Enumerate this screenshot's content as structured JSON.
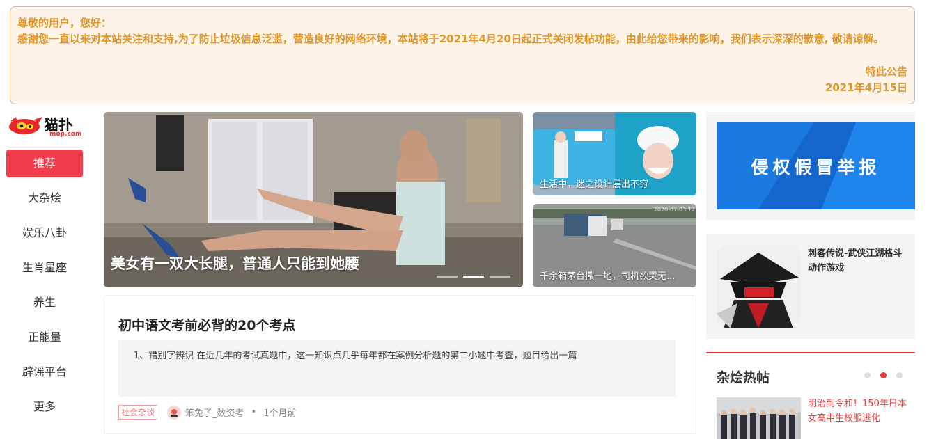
{
  "notice": {
    "greeting": "尊敬的用户，您好：",
    "body": "感谢您一直以来对本站关注和支持,为了防止垃圾信息泛滥，营造良好的网络环境，本站将于2021年4月20日起正式关闭发帖功能，由此给您带来的影响，我们表示深深的歉意, 敬请谅解。",
    "signature": "特此公告",
    "date": "2021年4月15日"
  },
  "logo": {
    "text": "猫扑",
    "domain": "mop.com"
  },
  "nav": {
    "items": [
      "推荐",
      "大杂烩",
      "娱乐八卦",
      "生肖星座",
      "养生",
      "正能量",
      "辟谣平台",
      "更多"
    ]
  },
  "hero": {
    "title": "美女有一双大长腿，普通人只能到她腰",
    "active_slide": 2,
    "slide_count": 3
  },
  "side_cards": [
    {
      "caption": "生活中，迷之设计层出不穷"
    },
    {
      "caption": "千余箱茅台撒一地，司机欲哭无...",
      "timestamp": "2020-07-03 12"
    }
  ],
  "article": {
    "title": "初中语文考前必背的20个考点",
    "excerpt": "1、错别字辨识 在近几年的考试真题中，这一知识点几乎每年都在案例分析题的第二小题中考查，题目给出一篇",
    "tag": "社会杂谈",
    "author": "笨兔子_数资考",
    "separator": "•",
    "time": "1个月前"
  },
  "right": {
    "report_label": "侵权假冒举报",
    "game_title": "刺客传说-武侠江湖格斗动作游戏",
    "hot_title": "杂烩热帖",
    "hot_active_dot": 2,
    "hot_item_text": "明治到令和！150年日本女高中生校服进化"
  },
  "colors": {
    "accent": "#f03c4b",
    "notice_text": "#e0962a",
    "notice_bg": "#fdf3e8",
    "report_bg": "#1a73d8"
  }
}
